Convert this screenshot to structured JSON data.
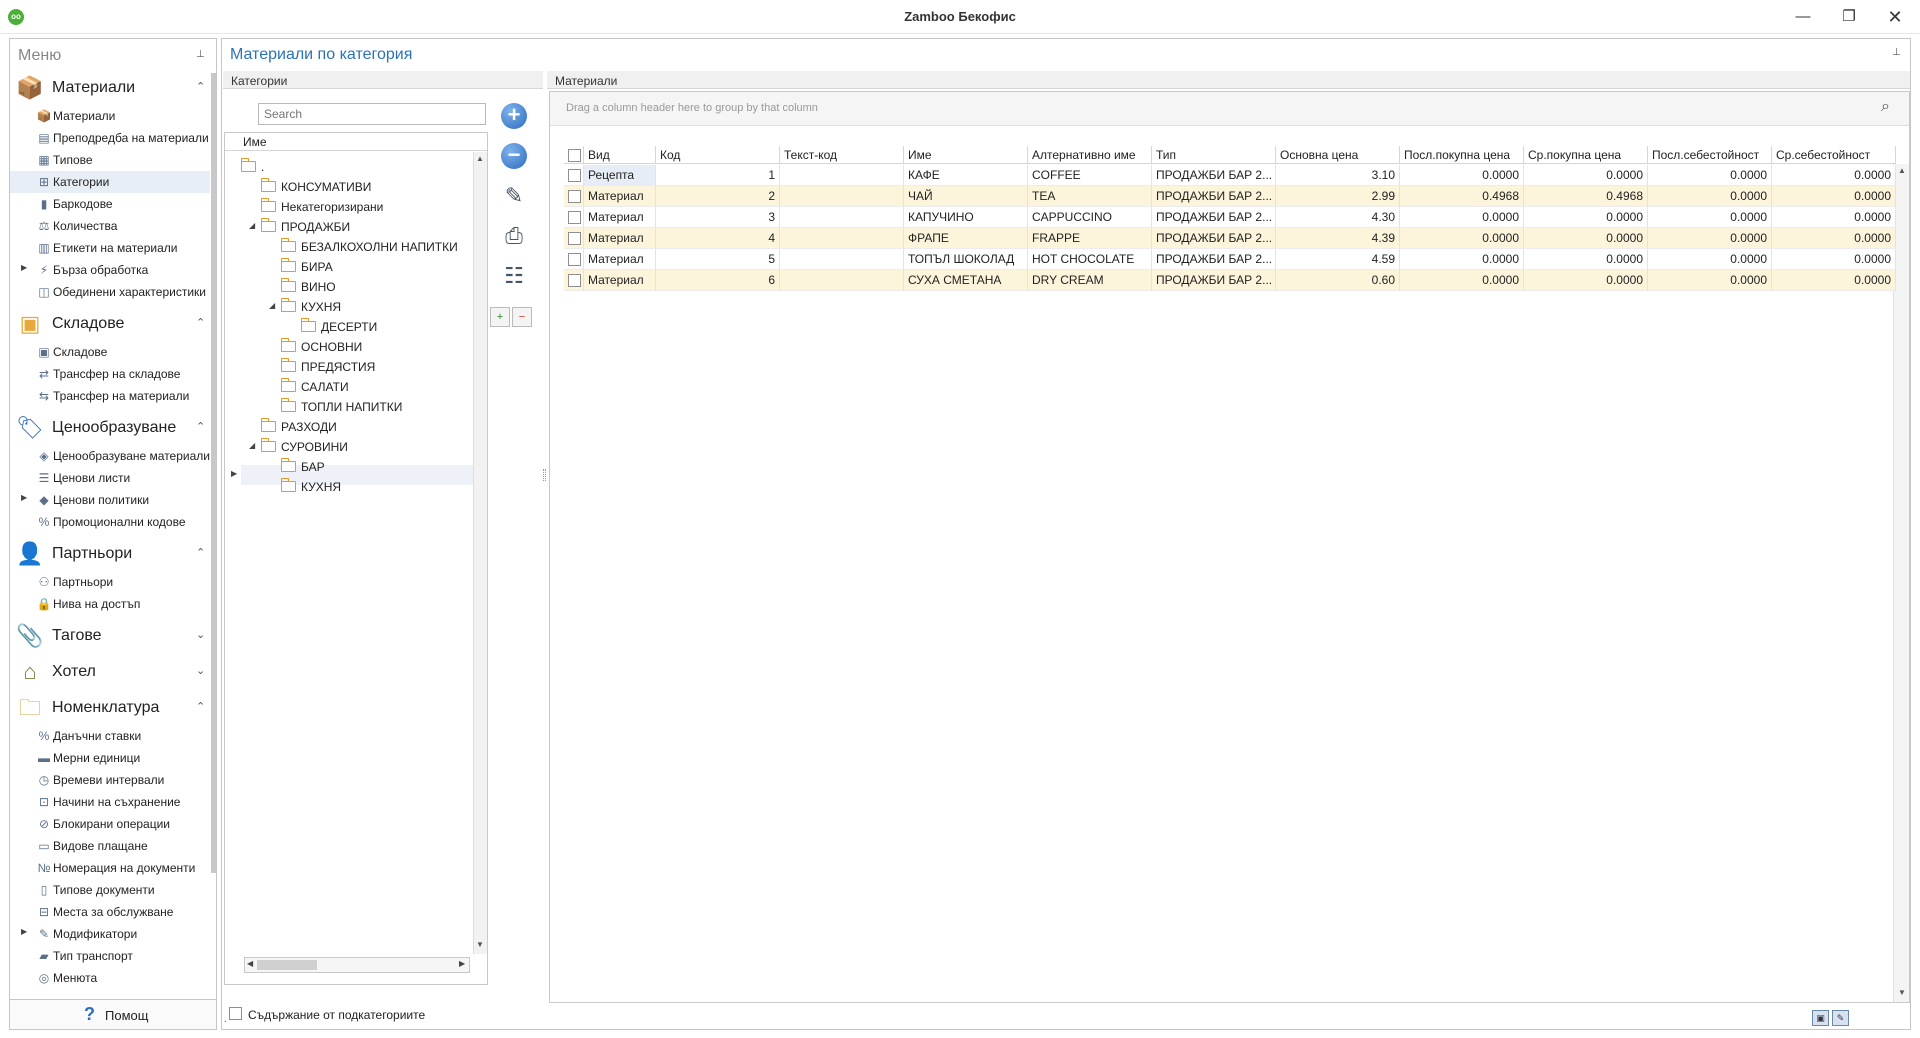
{
  "window": {
    "title": "Zamboo Бекофис",
    "logo_text": "oo",
    "minimize": "—",
    "maximize": "❐",
    "close": "✕"
  },
  "menu": {
    "header": "Меню",
    "pin": "⊥",
    "help_label": "Помощ",
    "groups": [
      {
        "label": "Материали",
        "icon": "box-icon",
        "chevron": "⌃",
        "items": [
          {
            "label": "Материали",
            "icon": "box-icon"
          },
          {
            "label": "Преподредба на материали",
            "icon": "reorder-icon"
          },
          {
            "label": "Типове",
            "icon": "types-icon"
          },
          {
            "label": "Категории",
            "icon": "tree-icon",
            "selected": true
          },
          {
            "label": "Баркодове",
            "icon": "barcode-icon"
          },
          {
            "label": "Количества",
            "icon": "quantities-icon"
          },
          {
            "label": "Етикети на материали",
            "icon": "labels-icon"
          },
          {
            "label": "Бърза обработка",
            "icon": "fast-processing-icon",
            "expandable": true
          },
          {
            "label": "Обединени характеристики",
            "icon": "merged-icon"
          }
        ]
      },
      {
        "label": "Складове",
        "icon": "warehouse-icon",
        "chevron": "⌃",
        "items": [
          {
            "label": "Складове",
            "icon": "warehouse-icon"
          },
          {
            "label": "Трансфер на складове",
            "icon": "transfer-icon"
          },
          {
            "label": "Трансфер на материали",
            "icon": "transfer-materials-icon"
          }
        ]
      },
      {
        "label": "Ценообразуване",
        "icon": "price-tag-icon",
        "chevron": "⌃",
        "items": [
          {
            "label": "Ценообразуване материали",
            "icon": "pricing-icon"
          },
          {
            "label": "Ценови листи",
            "icon": "price-list-icon"
          },
          {
            "label": "Ценови политики",
            "icon": "price-policy-icon",
            "expandable": true
          },
          {
            "label": "Промоционални кодове",
            "icon": "percent-icon"
          }
        ]
      },
      {
        "label": "Партньори",
        "icon": "partner-icon",
        "chevron": "⌃",
        "items": [
          {
            "label": "Партньори",
            "icon": "partners-icon"
          },
          {
            "label": "Нива на достъп",
            "icon": "lock-icon"
          }
        ]
      },
      {
        "label": "Тагове",
        "icon": "paperclip-icon",
        "chevron": "⌄",
        "items": []
      },
      {
        "label": "Хотел",
        "icon": "house-icon",
        "chevron": "⌄",
        "items": []
      },
      {
        "label": "Номенклатура",
        "icon": "folder-icon",
        "chevron": "⌃",
        "items": [
          {
            "label": "Данъчни ставки",
            "icon": "percent-icon"
          },
          {
            "label": "Мерни единици",
            "icon": "ruler-icon"
          },
          {
            "label": "Времеви интервали",
            "icon": "clock-icon"
          },
          {
            "label": "Начини на съхранение",
            "icon": "storage-icon"
          },
          {
            "label": "Блокирани операции",
            "icon": "blocked-icon"
          },
          {
            "label": "Видове плащане",
            "icon": "payment-icon"
          },
          {
            "label": "Номерация на документи",
            "icon": "numbering-icon"
          },
          {
            "label": "Типове документи",
            "icon": "document-icon"
          },
          {
            "label": "Места за обслужване",
            "icon": "tables-icon"
          },
          {
            "label": "Модификатори",
            "icon": "modifier-icon",
            "expandable": true
          },
          {
            "label": "Тип транспорт",
            "icon": "transport-icon"
          },
          {
            "label": "Менюта",
            "icon": "menu-book-icon"
          }
        ]
      }
    ]
  },
  "main": {
    "title": "Материали по категория",
    "pin": "⊥"
  },
  "categories": {
    "header": "Категории",
    "search_placeholder": "Search",
    "tree_column": "Име",
    "nodes": [
      {
        "label": ".",
        "level": 0,
        "expanded": false
      },
      {
        "label": "КОНСУМАТИВИ",
        "level": 1
      },
      {
        "label": "Некатегоризирани",
        "level": 1
      },
      {
        "label": "ПРОДАЖБИ",
        "level": 1,
        "expanded": true
      },
      {
        "label": "БЕЗАЛКОХОЛНИ НАПИТКИ",
        "level": 2
      },
      {
        "label": "БИРА",
        "level": 2
      },
      {
        "label": "ВИНО",
        "level": 2
      },
      {
        "label": "КУХНЯ",
        "level": 2,
        "expanded": true
      },
      {
        "label": "ДЕСЕРТИ",
        "level": 3
      },
      {
        "label": "ОСНОВНИ",
        "level": 2
      },
      {
        "label": "ПРЕДЯСТИЯ",
        "level": 2
      },
      {
        "label": "САЛАТИ",
        "level": 2
      },
      {
        "label": "ТОПЛИ НАПИТКИ",
        "level": 2,
        "current": true
      },
      {
        "label": "РАЗХОДИ",
        "level": 1
      },
      {
        "label": "СУРОВИНИ",
        "level": 1,
        "expanded": true
      },
      {
        "label": "БАР",
        "level": 2
      },
      {
        "label": "КУХНЯ",
        "level": 2
      }
    ],
    "include_subcategories": "Съдържание от подкатегориите"
  },
  "toolbar": {
    "add": "+",
    "remove": "−",
    "edit_icon": "edit-icon",
    "print_icon": "print-icon",
    "hierarchy_icon": "hierarchy-icon",
    "expand_all": "+",
    "collapse_all": "−"
  },
  "materials": {
    "header": "Материали",
    "group_hint": "Drag a column header here to group by that column",
    "columns": [
      "Вид",
      "Код",
      "Текст-код",
      "Име",
      "Алтернативно име",
      "Тип",
      "Основна цена",
      "Посл.покупна цена",
      "Ср.покупна цена",
      "Посл.себестойност",
      "Ср.себестойност"
    ],
    "rows": [
      [
        "Рецепта",
        "1",
        "",
        "КАФЕ",
        "COFFEE",
        "ПРОДАЖБИ БАР 2...",
        "3.10",
        "0.0000",
        "0.0000",
        "0.0000",
        "0.0000"
      ],
      [
        "Материал",
        "2",
        "",
        "ЧАЙ",
        "TEA",
        "ПРОДАЖБИ БАР 2...",
        "2.99",
        "0.4968",
        "0.4968",
        "0.0000",
        "0.0000"
      ],
      [
        "Материал",
        "3",
        "",
        "КАПУЧИНО",
        "CAPPUCCINO",
        "ПРОДАЖБИ БАР 2...",
        "4.30",
        "0.0000",
        "0.0000",
        "0.0000",
        "0.0000"
      ],
      [
        "Материал",
        "4",
        "",
        "ФРАПЕ",
        "FRAPPE",
        "ПРОДАЖБИ БАР 2...",
        "4.39",
        "0.0000",
        "0.0000",
        "0.0000",
        "0.0000"
      ],
      [
        "Материал",
        "5",
        "",
        "ТОПЪЛ ШОКОЛАД",
        "HOT CHOCOLATE",
        "ПРОДАЖБИ БАР 2...",
        "4.59",
        "0.0000",
        "0.0000",
        "0.0000",
        "0.0000"
      ],
      [
        "Материал",
        "6",
        "",
        "СУХА СМЕТАНА",
        "DRY CREAM",
        "ПРОДАЖБИ БАР 2...",
        "0.60",
        "0.0000",
        "0.0000",
        "0.0000",
        "0.0000"
      ]
    ]
  },
  "status": {
    "dot": ".",
    "save_layout_icon": "save-layout-icon",
    "reset_layout_icon": "reset-layout-icon"
  },
  "colors": {
    "accent": "#2b72b8",
    "row_alt": "#fdf4dc",
    "folder": "#e29a2f"
  }
}
